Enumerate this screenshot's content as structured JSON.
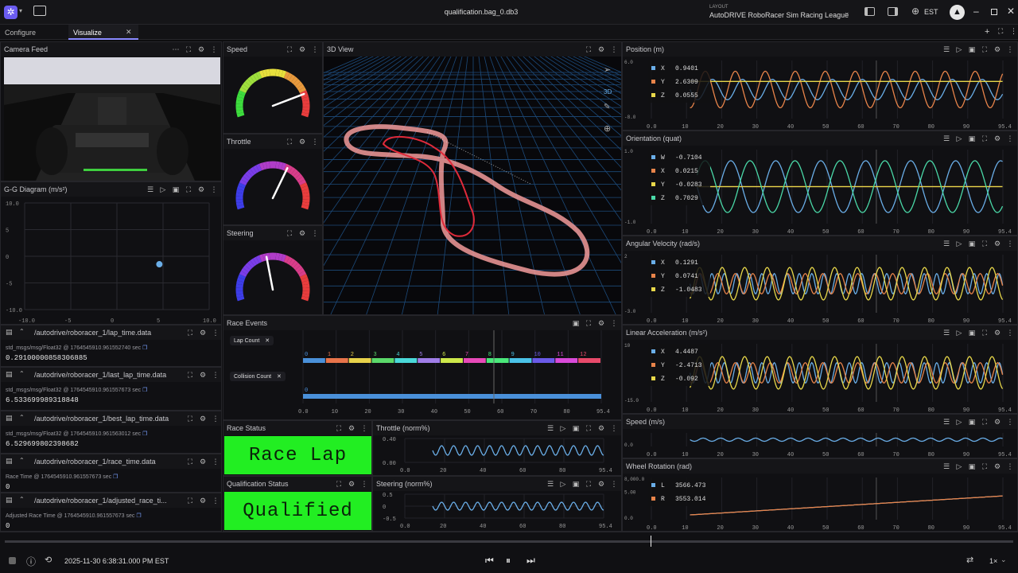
{
  "title": "qualification.bag_0.db3",
  "layout": {
    "label": "LAYOUT",
    "name": "AutoDRIVE RoboRacer Sim Racing League"
  },
  "timezone": "EST",
  "tabs": [
    {
      "label": "Configure"
    },
    {
      "label": "Visualize"
    }
  ],
  "camera": {
    "title": "Camera Feed"
  },
  "gg": {
    "title": "G-G Diagram (m/s²)",
    "yticks": [
      "10.0",
      "5",
      "0",
      "-5",
      "-10.0"
    ],
    "xticks": [
      "-10.0",
      "-5",
      "0",
      "5",
      "10.0"
    ],
    "point": [
      4.6,
      -1.5
    ]
  },
  "gauges": [
    {
      "title": "Speed",
      "value": 0.82
    },
    {
      "title": "Throttle",
      "value": 0.62
    },
    {
      "title": "Steering",
      "value": 0.45
    }
  ],
  "view3d": {
    "title": "3D View",
    "mode": "3D"
  },
  "raw": [
    {
      "topic": "/autodrive/roboracer_1/lap_time.data",
      "meta": "std_msgs/msg/Float32 @ 1764545910.961552740 sec",
      "value": "0.29100000858306885"
    },
    {
      "topic": "/autodrive/roboracer_1/last_lap_time.data",
      "meta": "std_msgs/msg/Float32 @ 1764545910.961557673 sec",
      "value": "6.533699989318848"
    },
    {
      "topic": "/autodrive/roboracer_1/best_lap_time.data",
      "meta": "std_msgs/msg/Float32 @ 1764545910.961563012 sec",
      "value": "6.529699802398682"
    },
    {
      "topic": "/autodrive/roboracer_1/race_time.data",
      "meta": "Race Time @ 1764545910.961557673 sec",
      "value": "0"
    },
    {
      "topic": "/autodrive/roboracer_1/adjusted_race_ti...",
      "meta": "Adjusted Race Time @ 1764545910.961557673 sec",
      "value": "0"
    }
  ],
  "race_events": {
    "title": "Race Events",
    "rows": [
      "Lap Count",
      "Collision Count"
    ],
    "lap_labels": [
      "0",
      "1",
      "2",
      "3",
      "4",
      "5",
      "6",
      "7",
      "8",
      "9",
      "10",
      "11",
      "12"
    ],
    "collision_label": "0",
    "xticks": [
      "0.0",
      "10",
      "20",
      "30",
      "40",
      "50",
      "60",
      "70",
      "80",
      "95.4"
    ],
    "lap_colors": [
      "#4a90d9",
      "#e8744a",
      "#e8d24a",
      "#5bd96a",
      "#4ad9d9",
      "#a07ee8",
      "#cde84a",
      "#e84ab8",
      "#4ae87a",
      "#4ac2e8",
      "#6a5ae8",
      "#d94ad9",
      "#e84a6a"
    ]
  },
  "race_status": {
    "title": "Race Status",
    "value": "Race Lap"
  },
  "qual_status": {
    "title": "Qualification Status",
    "value": "Qualified"
  },
  "throttle_plot": {
    "title": "Throttle (norm%)",
    "yticks": [
      "0.40",
      "0.00"
    ],
    "xticks": [
      "0.0",
      "20",
      "40",
      "60",
      "80",
      "95.4"
    ]
  },
  "steering_plot": {
    "title": "Steering (norm%)",
    "yticks": [
      "0.5",
      "0",
      "-0.5"
    ],
    "xticks": [
      "0.0",
      "20",
      "40",
      "60",
      "80",
      "95.4"
    ]
  },
  "plots": [
    {
      "title": "Position (m)",
      "ymax": "6.0",
      "ymin": "-8.0",
      "legend": [
        {
          "k": "X",
          "v": "0.9401",
          "c": "#6aaee8"
        },
        {
          "k": "Y",
          "v": "2.6309",
          "c": "#e8844a"
        },
        {
          "k": "Z",
          "v": "0.0555",
          "c": "#e8d84a"
        }
      ]
    },
    {
      "title": "Orientation (quat)",
      "ymax": "1.0",
      "ymin": "-1.0",
      "legend": [
        {
          "k": "W",
          "v": "-0.7104",
          "c": "#6aaee8"
        },
        {
          "k": "X",
          "v": "0.0215",
          "c": "#e8844a"
        },
        {
          "k": "Y",
          "v": "-0.0283",
          "c": "#e8d84a"
        },
        {
          "k": "Z",
          "v": "0.7029",
          "c": "#4ad9a8"
        }
      ]
    },
    {
      "title": "Angular Velocity (rad/s)",
      "ymax": "2",
      "ymin": "-3.0",
      "legend": [
        {
          "k": "X",
          "v": "0.1291",
          "c": "#6aaee8"
        },
        {
          "k": "Y",
          "v": "0.0741",
          "c": "#e8844a"
        },
        {
          "k": "Z",
          "v": "-1.0483",
          "c": "#e8d84a"
        }
      ]
    },
    {
      "title": "Linear Acceleration (m/s²)",
      "ymax": "10",
      "ymin": "-15.0",
      "legend": [
        {
          "k": "X",
          "v": "4.4487",
          "c": "#6aaee8"
        },
        {
          "k": "Y",
          "v": "-2.4713",
          "c": "#e8844a"
        },
        {
          "k": "Z",
          "v": "-0.092",
          "c": "#e8d84a"
        }
      ]
    },
    {
      "title": "Speed (m/s)",
      "ymax": "",
      "ymin": "0.0",
      "legend": []
    },
    {
      "title": "Wheel Rotation (rad)",
      "ymax": "8,000.0",
      "ymin": "0.0",
      "mid": "5.00",
      "legend": [
        {
          "k": "L",
          "v": "3566.473",
          "c": "#6aaee8"
        },
        {
          "k": "R",
          "v": "3553.014",
          "c": "#e8844a"
        }
      ]
    }
  ],
  "plot_xticks": [
    "0.0",
    "10",
    "20",
    "30",
    "40",
    "50",
    "60",
    "70",
    "80",
    "90",
    "95.4"
  ],
  "playback": {
    "timestamp": "2025-11-30 6:38:31.000 PM EST",
    "speed": "1×",
    "progress": 0.64
  }
}
